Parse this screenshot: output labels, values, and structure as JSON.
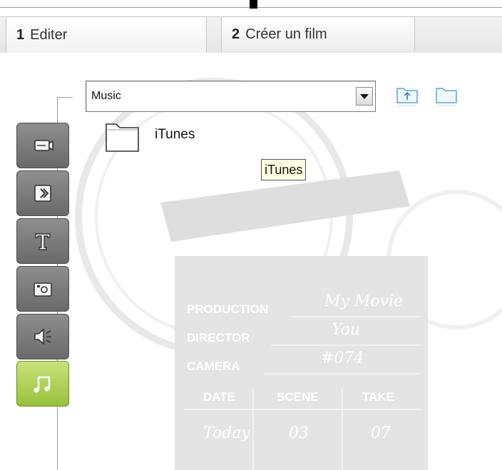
{
  "tabs": [
    {
      "number": "1",
      "label": "Editer",
      "active": true
    },
    {
      "number": "2",
      "label": "Créer un film",
      "active": false
    }
  ],
  "folder_select": {
    "value": "Music"
  },
  "toolbar": {
    "up_folder_icon": "folder-up-icon",
    "new_folder_icon": "new-folder-icon"
  },
  "side_tools": [
    {
      "icon": "video-camera-icon",
      "active": false
    },
    {
      "icon": "transition-icon",
      "active": false
    },
    {
      "icon": "text-icon",
      "active": false
    },
    {
      "icon": "photo-icon",
      "active": false
    },
    {
      "icon": "speaker-icon",
      "active": false
    },
    {
      "icon": "music-note-icon",
      "active": true
    }
  ],
  "files": [
    {
      "name": "iTunes",
      "type": "folder"
    }
  ],
  "tooltip": {
    "text": "iTunes"
  },
  "watermark": {
    "rows": [
      "PRODUCTION",
      "DIRECTOR",
      "CAMERA"
    ],
    "handwritten": [
      "My Movie",
      "You",
      "#074"
    ],
    "columns": [
      "DATE",
      "SCENE",
      "TAKE"
    ],
    "column_values": [
      "Today",
      "03",
      "07"
    ]
  },
  "colors": {
    "accent": "#9bc43c",
    "tool_bg": "#7a7a7a",
    "tooltip_bg": "#ffffe1"
  }
}
